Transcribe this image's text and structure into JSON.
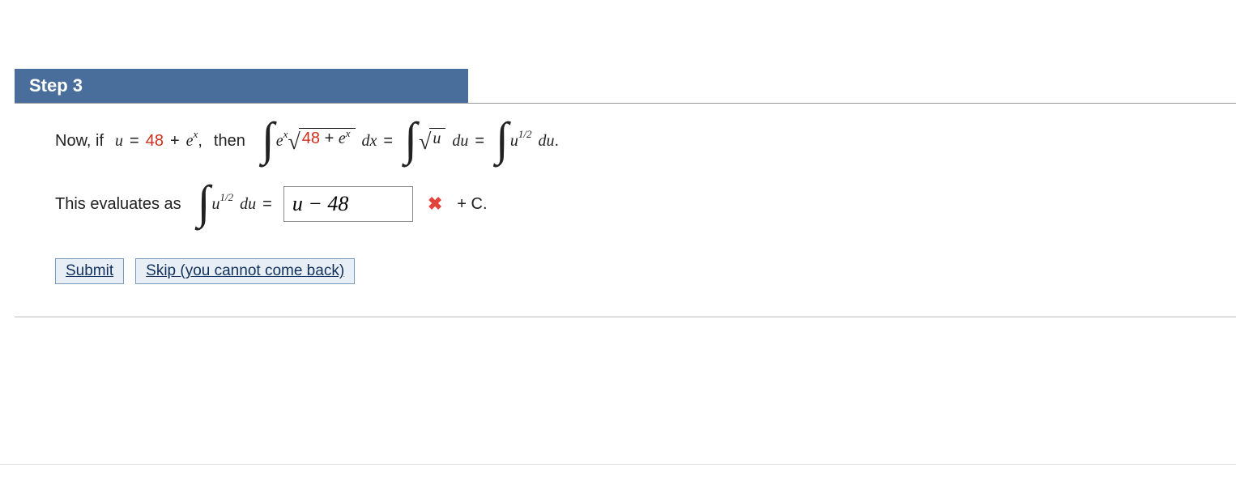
{
  "step": {
    "label": "Step 3"
  },
  "line1": {
    "prefix": "Now, if",
    "u_eq_lhs": "u",
    "eq": "=",
    "const48": "48",
    "plus": "+",
    "e": "e",
    "x": "x",
    "comma_then": ",",
    "then": "then",
    "dx": "dx",
    "du": "du",
    "half": "1/2",
    "period": "."
  },
  "line2": {
    "prefix": "This evaluates as",
    "half": "1/2",
    "du": "du",
    "eq": "=",
    "answer_value": "u − 48",
    "plusC": "+ C."
  },
  "buttons": {
    "submit": "Submit",
    "skip": "Skip (you cannot come back)"
  }
}
